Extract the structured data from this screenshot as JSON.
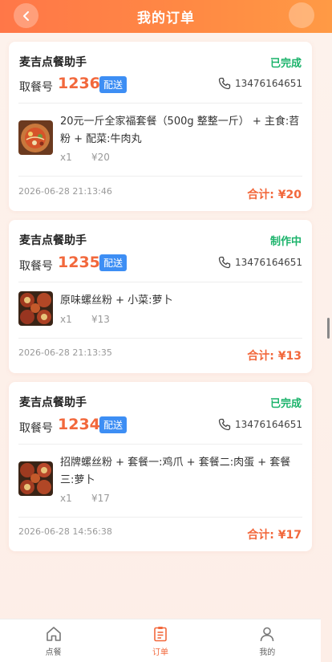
{
  "header": {
    "title": "我的订单"
  },
  "orders": [
    {
      "shop_name": "麦吉点餐助手",
      "status": "已完成",
      "status_color": "#1bb36b",
      "pickup_label": "取餐号",
      "pickup_number": "1236",
      "delivery_tag": "配送",
      "phone": "13476164651",
      "item_name": "20元一斤全家福套餐（500g 整整一斤） + 主食:苕粉 + 配菜:牛肉丸",
      "item_qty": "x1",
      "item_price": "¥20",
      "time": "2026-06-28 21:13:46",
      "total": "合计: ¥20"
    },
    {
      "shop_name": "麦吉点餐助手",
      "status": "制作中",
      "status_color": "#1bb36b",
      "pickup_label": "取餐号",
      "pickup_number": "1235",
      "delivery_tag": "配送",
      "phone": "13476164651",
      "item_name": "原味螺丝粉 + 小菜:萝卜",
      "item_qty": "x1",
      "item_price": "¥13",
      "time": "2026-06-28 21:13:35",
      "total": "合计: ¥13"
    },
    {
      "shop_name": "麦吉点餐助手",
      "status": "已完成",
      "status_color": "#1bb36b",
      "pickup_label": "取餐号",
      "pickup_number": "1234",
      "delivery_tag": "配送",
      "phone": "13476164651",
      "item_name": "招牌螺丝粉 + 套餐一:鸡爪 + 套餐二:肉蛋 + 套餐三:萝卜",
      "item_qty": "x1",
      "item_price": "¥17",
      "time": "2026-06-28 14:56:38",
      "total": "合计: ¥17"
    }
  ],
  "tabbar": {
    "items": [
      {
        "label": "点餐",
        "icon": "home-icon"
      },
      {
        "label": "订单",
        "icon": "order-list-icon"
      },
      {
        "label": "我的",
        "icon": "user-icon"
      }
    ],
    "active_color": "#f2683c"
  }
}
